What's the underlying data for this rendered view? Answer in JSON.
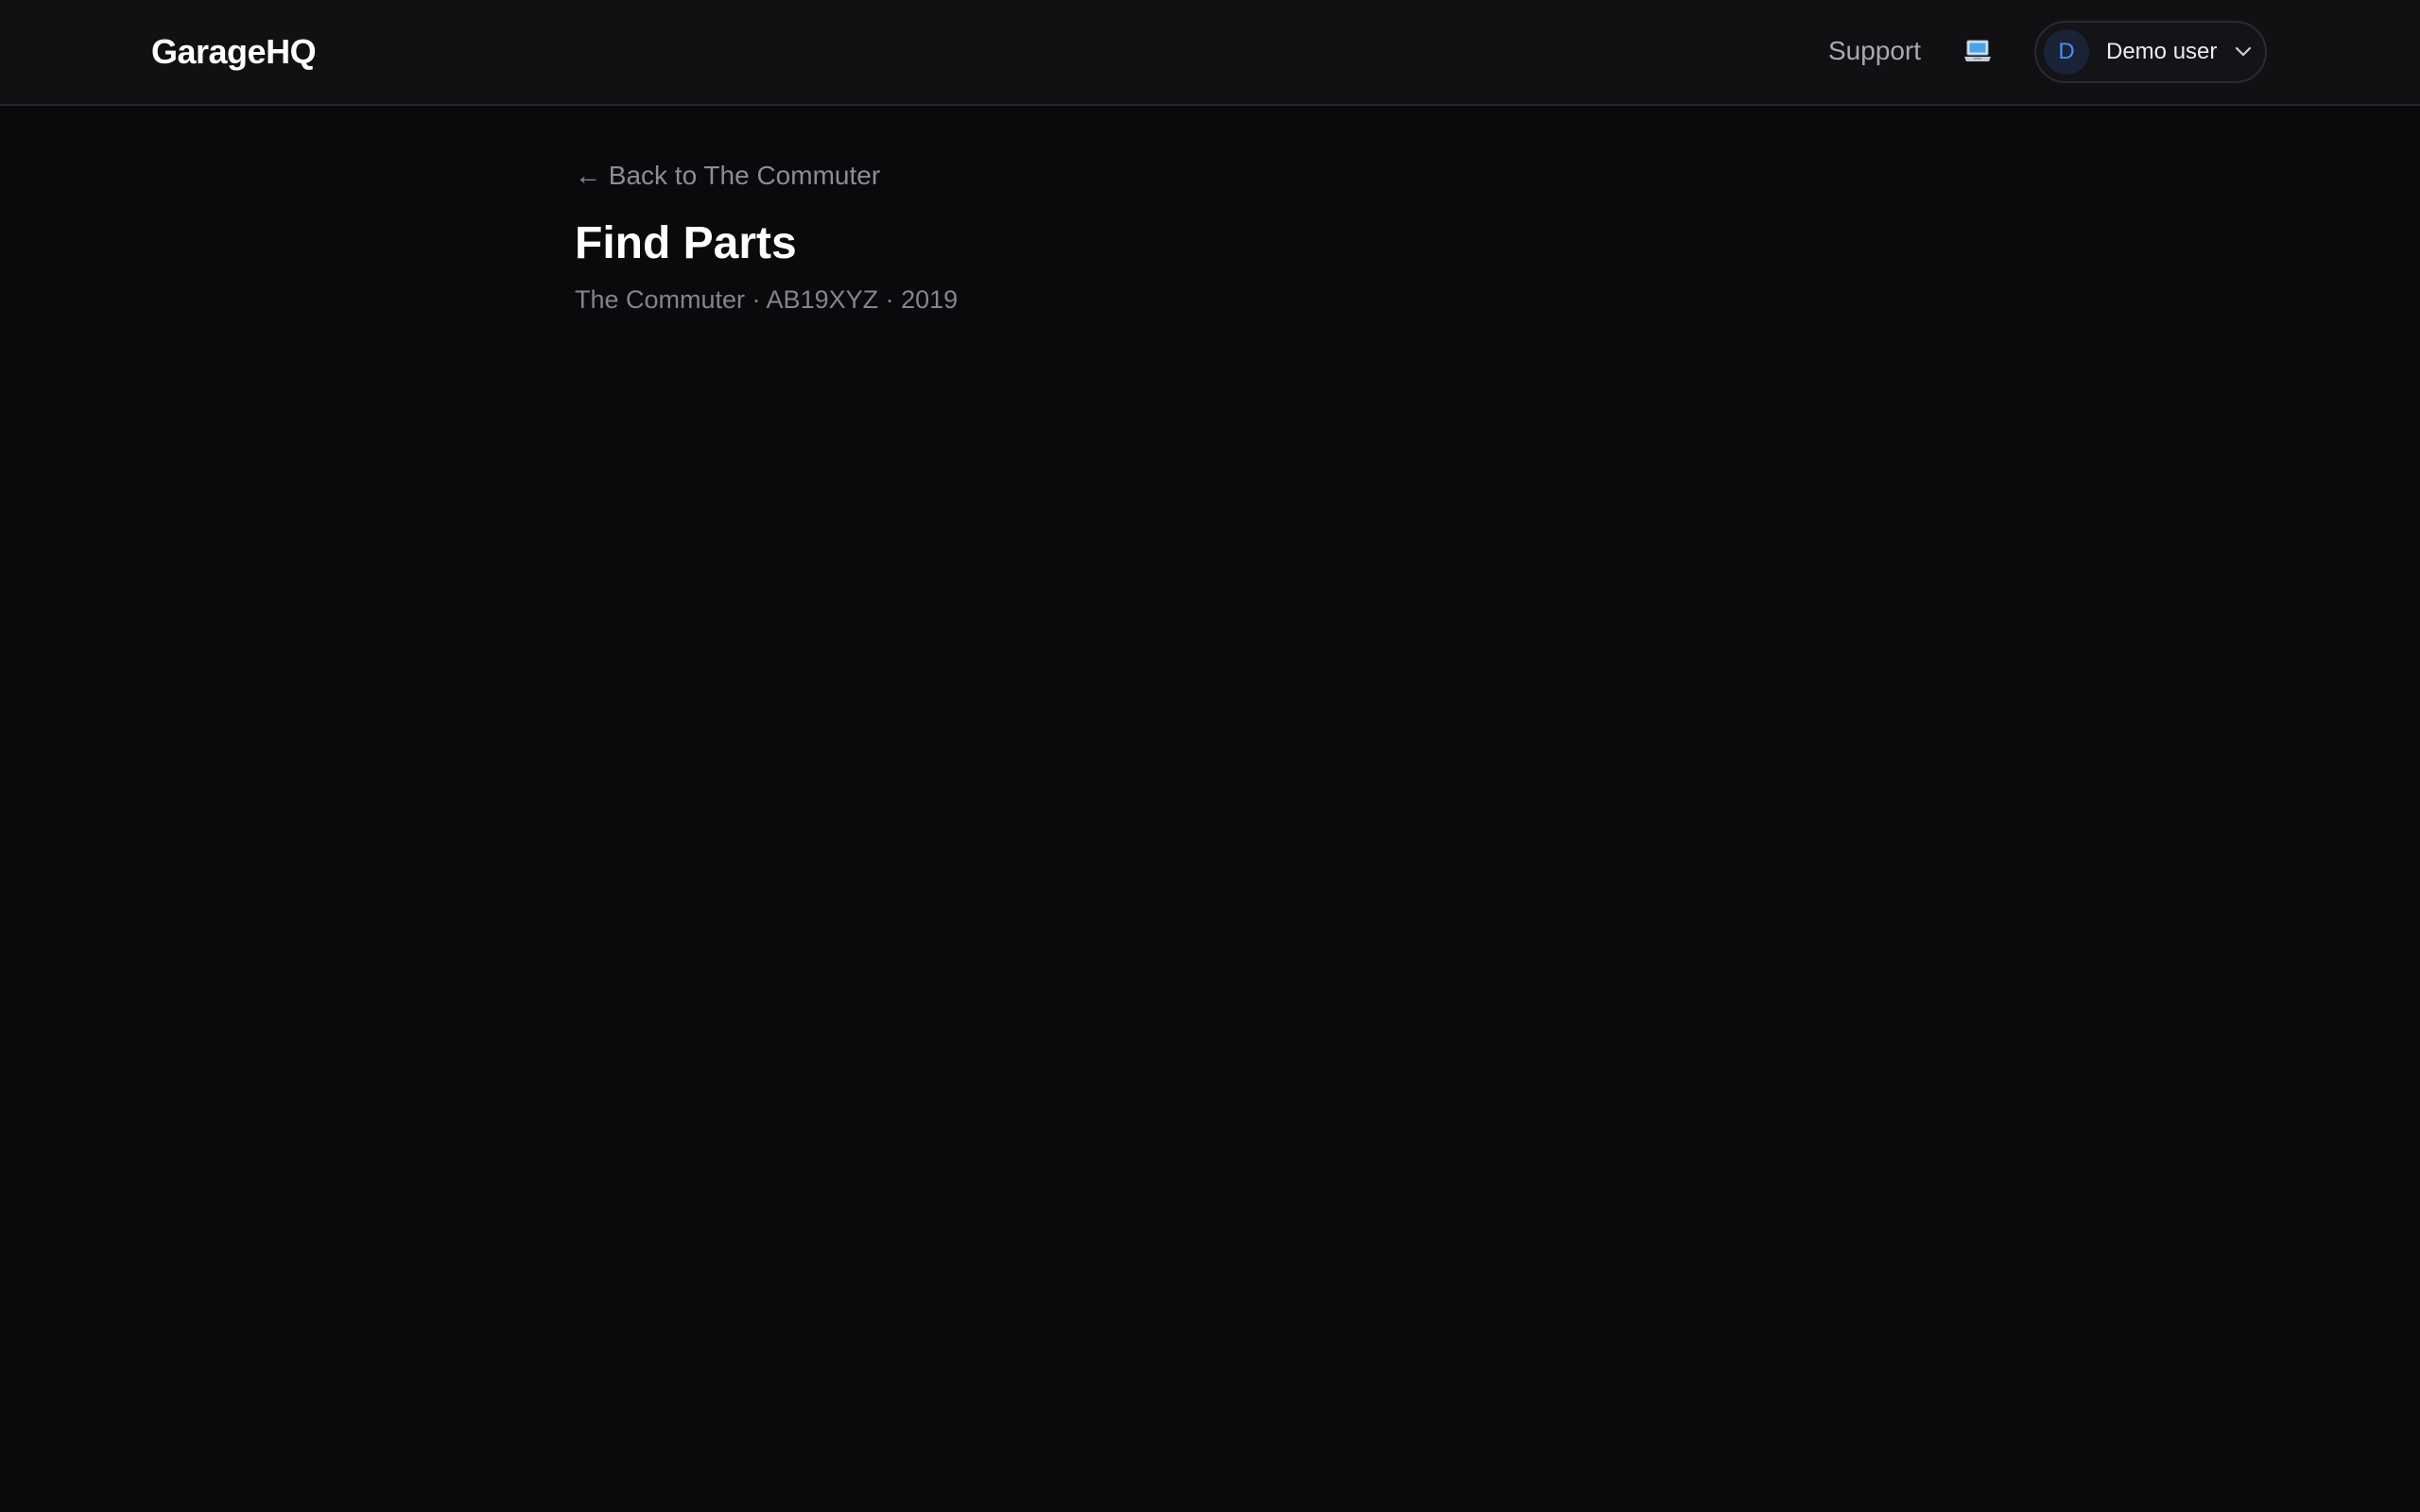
{
  "header": {
    "brand": "GarageHQ",
    "support_label": "Support",
    "theme_icon": "laptop-icon",
    "user": {
      "initial": "D",
      "name": "Demo user"
    }
  },
  "main": {
    "back_link": "← Back to The Commuter",
    "title": "Find Parts",
    "subtitle": "The Commuter · AB19XYZ · 2019"
  },
  "colors": {
    "background": "#0a0a0c",
    "header_background": "#111114",
    "avatar_accent": "#4d8df5",
    "muted_text": "#8c8c96"
  }
}
